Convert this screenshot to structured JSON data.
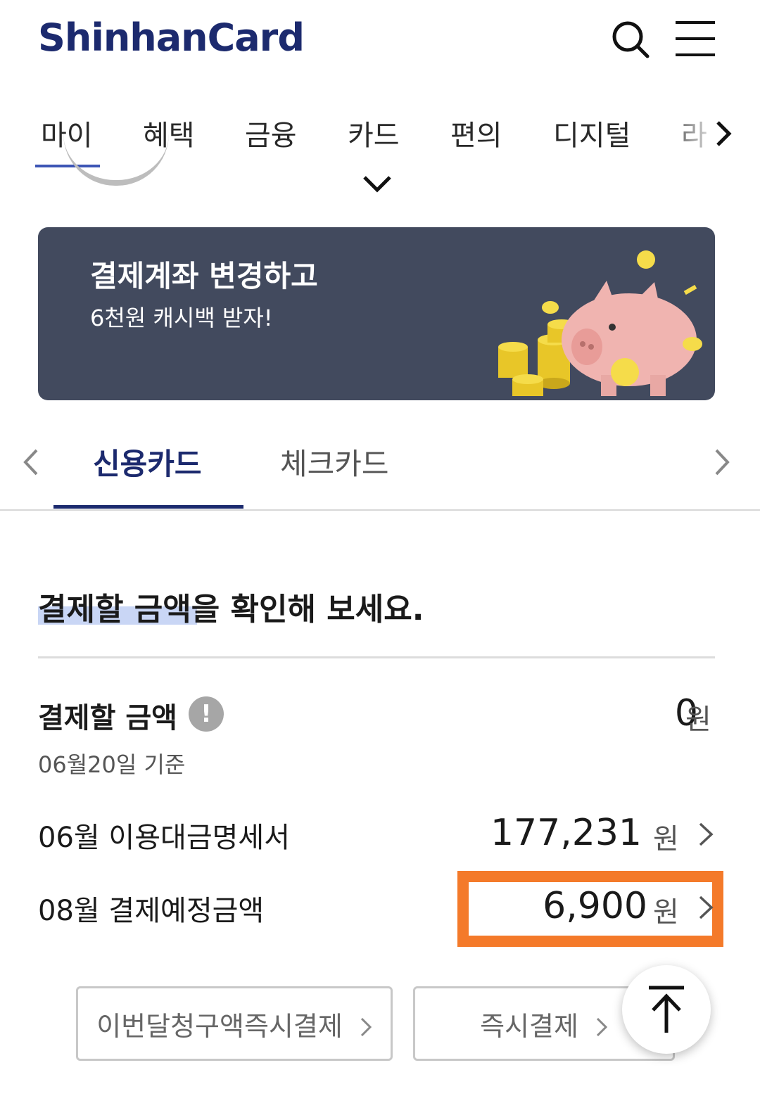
{
  "header": {
    "logo_text": "ShinhanCard",
    "search_icon": "search-icon",
    "menu_icon": "hamburger-menu-icon"
  },
  "category_nav": {
    "items": [
      "마이",
      "혜택",
      "금융",
      "카드",
      "편의",
      "디지털",
      "라"
    ],
    "active": "마이",
    "accent_color": "#3c55b5"
  },
  "banner": {
    "title": "결제계좌 변경하고",
    "subtitle": "6천원 캐시백 받자!",
    "background_color": "#424a5e",
    "art": "piggy-bank-with-coins"
  },
  "card_tabs": {
    "items": [
      "신용카드",
      "체크카드"
    ],
    "active": "신용카드",
    "accent_color": "#1c2a6e"
  },
  "section": {
    "title": "결제할 금액을 확인해 보세요."
  },
  "rows": [
    {
      "label": "결제할 금액",
      "sub": "06월20일 기준",
      "amount": "0",
      "unit": "원"
    },
    {
      "label": "06월 이용대금명세서",
      "amount": "177,231",
      "unit": "원"
    },
    {
      "label": "08월 결제예정금액",
      "amount": "6,900",
      "unit": "원",
      "highlight_color": "#f47a2a"
    }
  ],
  "buttons": {
    "pay_this_month": "이번달청구액즉시결제",
    "instant_pay": "즉시결제",
    "scroll_top_icon": "arrow-up-to-top-icon"
  }
}
